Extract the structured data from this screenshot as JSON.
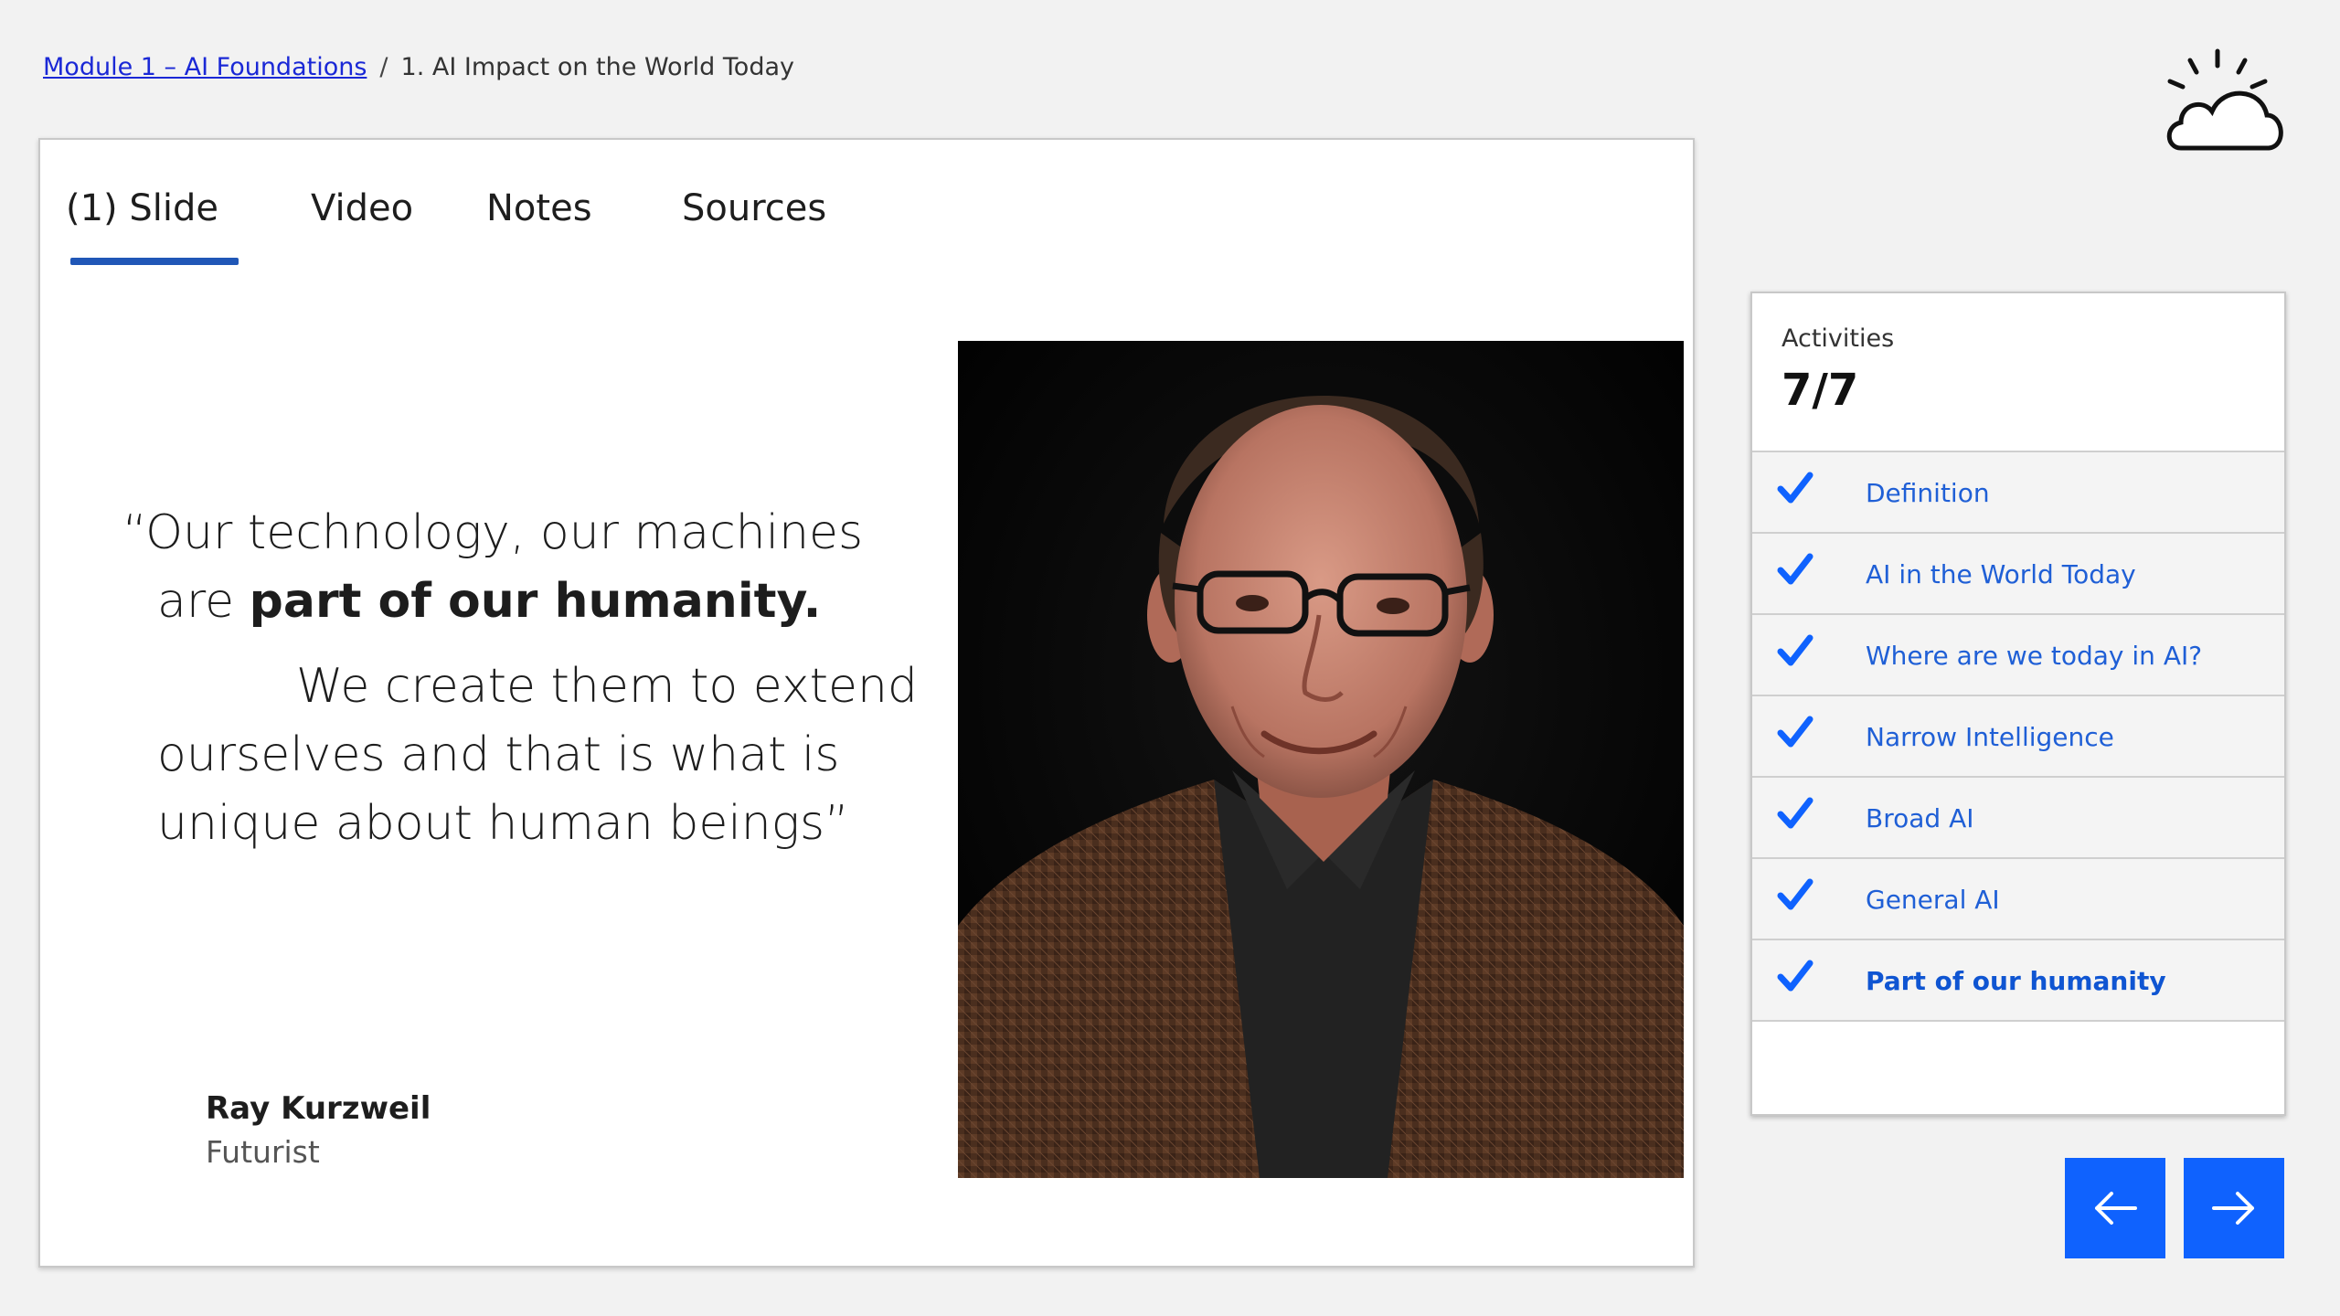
{
  "breadcrumb": {
    "parent": "Module 1 – AI Foundations",
    "separator": "/",
    "current": "1. AI Impact on the World Today"
  },
  "tabs": [
    {
      "label": "(1) Slide",
      "active": true
    },
    {
      "label": "Video"
    },
    {
      "label": "Notes"
    },
    {
      "label": "Sources"
    }
  ],
  "slide": {
    "quote_line1": "“Our technology, our machines",
    "quote_line2_prefix": "are ",
    "quote_line2_bold": "part of our humanity.",
    "quote_line3": "We create them to extend",
    "quote_line4": "ourselves and that is what is",
    "quote_line5": "unique about human beings”",
    "author_name": "Ray Kurzweil",
    "author_role": "Futurist"
  },
  "activities": {
    "label": "Activities",
    "count": "7/7",
    "items": [
      {
        "label": "Definition",
        "completed": true
      },
      {
        "label": "AI in the World Today",
        "completed": true
      },
      {
        "label": "Where are we today in AI?",
        "completed": true
      },
      {
        "label": "Narrow Intelligence",
        "completed": true
      },
      {
        "label": "Broad AI",
        "completed": true
      },
      {
        "label": "General AI",
        "completed": true
      },
      {
        "label": "Part of our humanity",
        "completed": true,
        "current": true
      }
    ]
  },
  "colors": {
    "accent": "#0f62fe",
    "link": "#1a28d6",
    "tab_underline": "#2057b7",
    "activity_text": "#1f5fd6"
  },
  "icons": {
    "logo": "sun-cloud-icon",
    "prev": "arrow-left-icon",
    "next": "arrow-right-icon",
    "check": "checkmark-icon"
  }
}
